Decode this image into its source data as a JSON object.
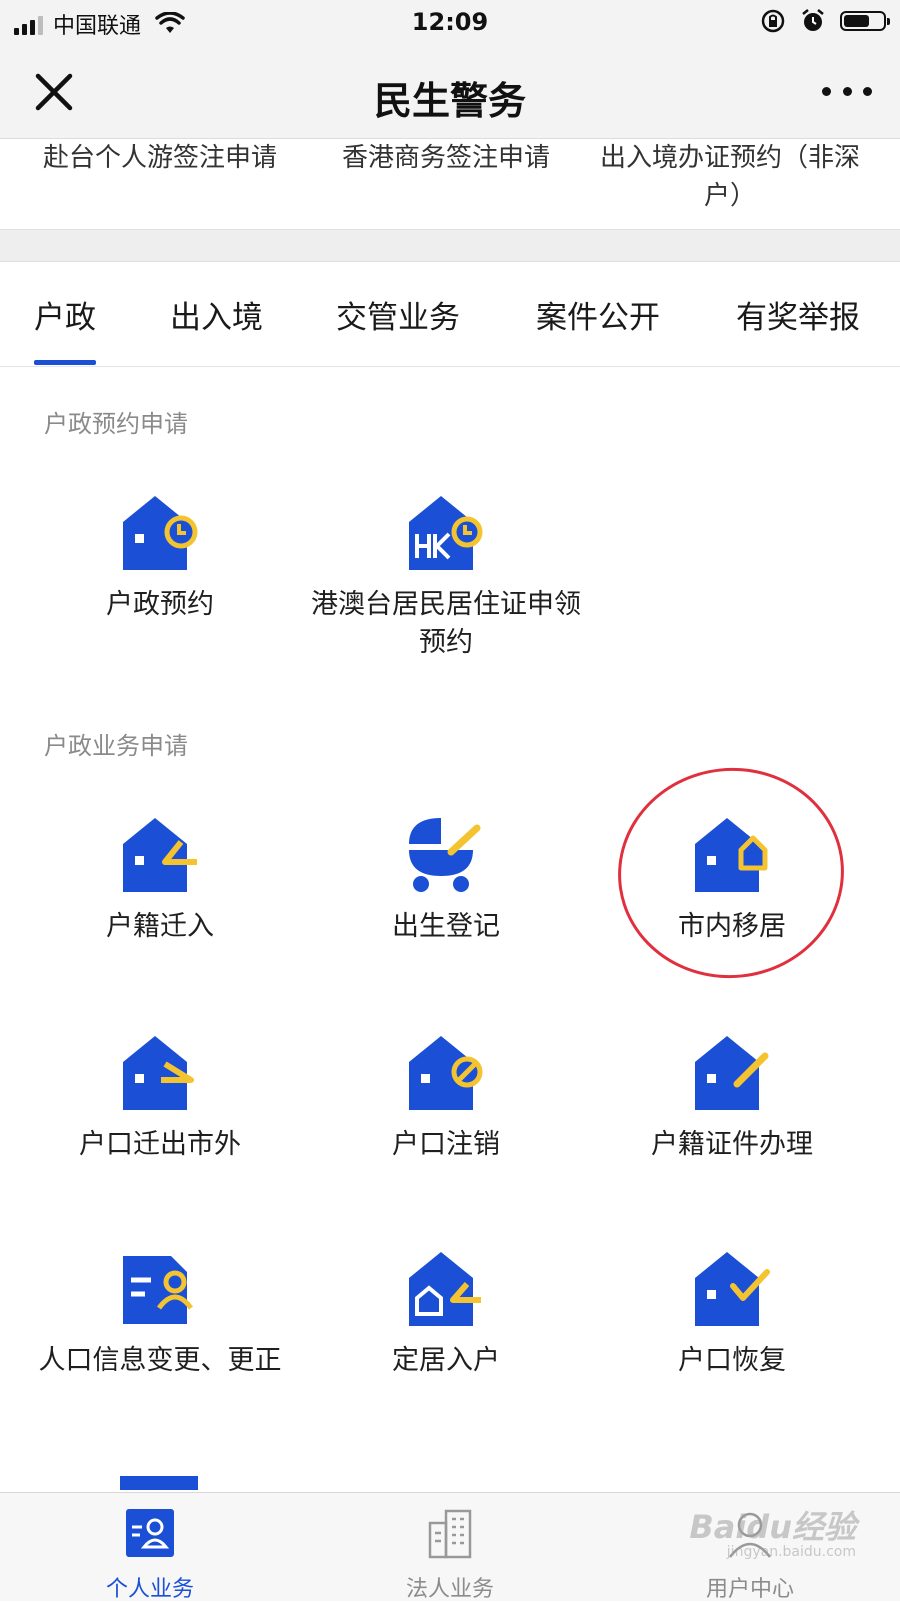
{
  "status_bar": {
    "carrier": "中国联通",
    "time": "12:09"
  },
  "nav": {
    "title": "民生警务"
  },
  "top_services": [
    {
      "label": "赴台个人游签注申请"
    },
    {
      "label": "香港商务签注申请"
    },
    {
      "label": "出入境办证预约（非深户）"
    }
  ],
  "tabs": [
    {
      "label": "户政",
      "active": true
    },
    {
      "label": "出入境"
    },
    {
      "label": "交管业务"
    },
    {
      "label": "案件公开"
    },
    {
      "label": "有奖举报"
    }
  ],
  "section_appointment": {
    "title": "户政预约申请",
    "items": [
      {
        "label": "户政预约",
        "icon": "house-clock-icon"
      },
      {
        "label": "港澳台居民居住证申领预约",
        "icon": "house-hk-clock-icon"
      }
    ]
  },
  "section_business": {
    "title": "户政业务申请",
    "items": [
      {
        "label": "户籍迁入",
        "icon": "house-move-in-icon"
      },
      {
        "label": "出生登记",
        "icon": "baby-stroller-icon"
      },
      {
        "label": "市内移居",
        "icon": "house-relocate-icon"
      },
      {
        "label": "户口迁出市外",
        "icon": "house-move-out-icon"
      },
      {
        "label": "户口注销",
        "icon": "house-cancel-icon"
      },
      {
        "label": "户籍证件办理",
        "icon": "house-edit-icon"
      },
      {
        "label": "人口信息变更、更正",
        "icon": "id-card-person-icon"
      },
      {
        "label": "定居入户",
        "icon": "house-settle-icon"
      },
      {
        "label": "户口恢复",
        "icon": "house-check-icon"
      }
    ]
  },
  "bottom_tabs": [
    {
      "label": "个人业务",
      "active": true,
      "icon": "person-card-icon"
    },
    {
      "label": "法人业务",
      "icon": "building-icon"
    },
    {
      "label": "用户中心",
      "icon": "user-icon"
    }
  ],
  "watermark": {
    "text": "Baidu经验",
    "sub": "jingyan.baidu.com"
  },
  "colors": {
    "brand_blue": "#1a4fd6",
    "accent_yellow": "#f4c430",
    "annotation_red": "#e0303e"
  }
}
